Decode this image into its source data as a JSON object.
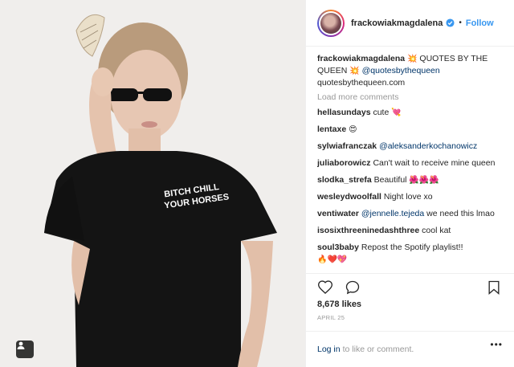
{
  "header": {
    "username": "frackowiakmagdalena",
    "follow_label": "Follow",
    "separator": "•"
  },
  "caption": {
    "username": "frackowiakmagdalena",
    "emoji1": "💥",
    "text": " QUOTES BY THE QUEEN ",
    "emoji2": "💥",
    "mention": "@quotesbythequeen",
    "link": "quotesbythequeen.com"
  },
  "load_more": "Load more comments",
  "comments": [
    {
      "user": "hellasundays",
      "text": "cute ",
      "emoji": "💘"
    },
    {
      "user": "lentaxe",
      "text": "",
      "emoji": "😍"
    },
    {
      "user": "sylwiafranczak",
      "text": "",
      "mention": "@aleksanderkochanowicz"
    },
    {
      "user": "juliaborowicz",
      "text": "Can't wait to receive mine queen"
    },
    {
      "user": "slodka_strefa",
      "text": "Beautiful ",
      "emoji": "🌺🌺🌺"
    },
    {
      "user": "wesleydwoolfall",
      "text": "Night love xo"
    },
    {
      "user": "ventiwater",
      "text": " we need this lmao",
      "mention": "@jennelle.tejeda"
    },
    {
      "user": "isosixthreeninedashthree",
      "text": "cool kat"
    },
    {
      "user": "soul3baby",
      "text": "Repost the Spotify playlist!!",
      "emoji": "🔥❤️💖"
    }
  ],
  "likes": "8,678 likes",
  "date": "APRIL 25",
  "login": {
    "link": "Log in",
    "text": "to like or comment.",
    "more": "•••"
  },
  "photo": {
    "shirt_text_line1": "BITCH CHILL",
    "shirt_text_line2": "YOUR HORSES"
  },
  "colors": {
    "accent": "#3897f0",
    "link": "#003569",
    "muted": "#999999",
    "text": "#262626"
  },
  "icons": [
    "heart-icon",
    "comment-icon",
    "bookmark-icon",
    "user-tag-icon",
    "verified-badge-icon"
  ]
}
